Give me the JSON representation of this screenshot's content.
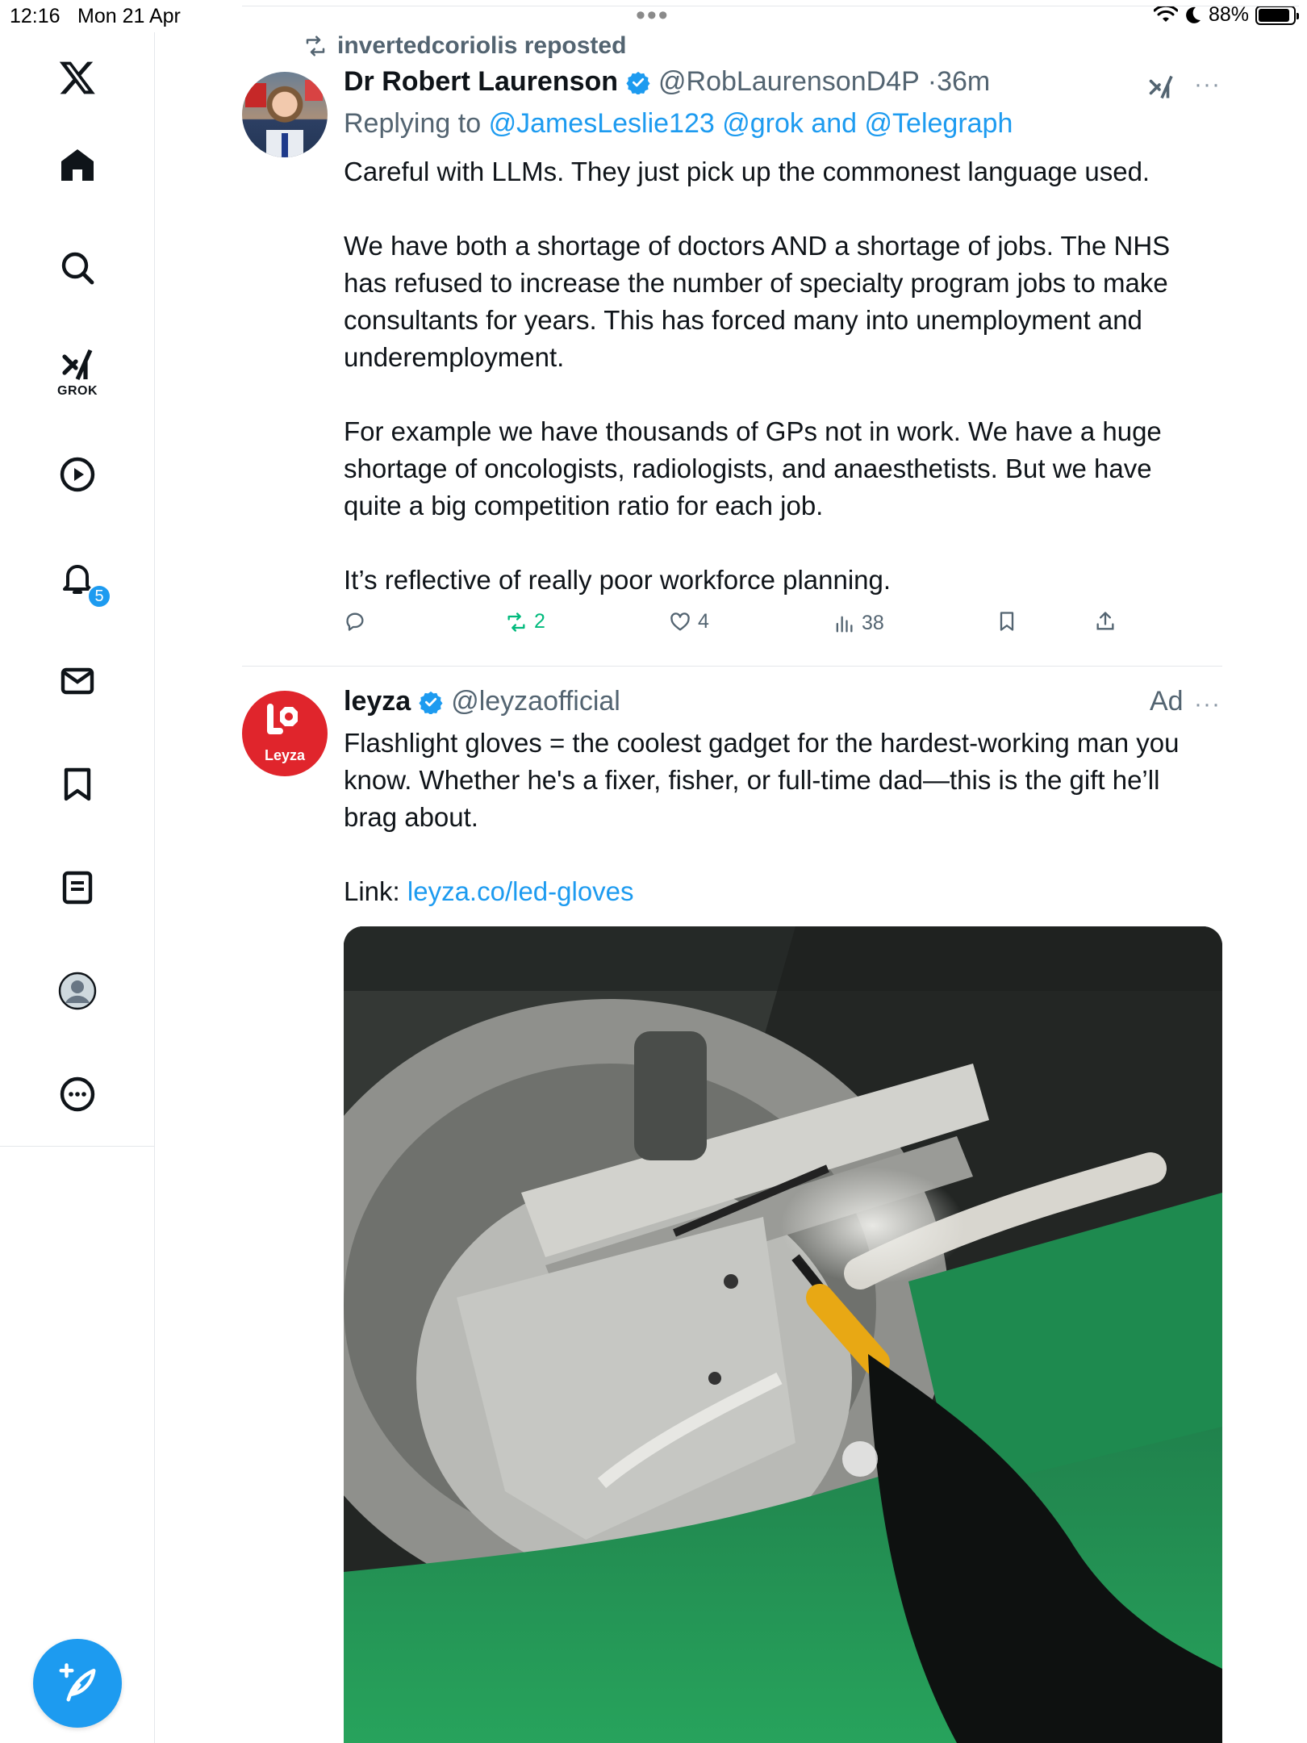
{
  "status_bar": {
    "time": "12:16",
    "date": "Mon 21 Apr",
    "battery": "88%",
    "battery_level": 0.88
  },
  "sidebar": {
    "items": [
      {
        "name": "x-logo",
        "label": ""
      },
      {
        "name": "home",
        "label": ""
      },
      {
        "name": "search",
        "label": ""
      },
      {
        "name": "grok",
        "label": "GROK"
      },
      {
        "name": "video",
        "label": ""
      },
      {
        "name": "notifications",
        "label": "",
        "badge": "5"
      },
      {
        "name": "messages",
        "label": ""
      },
      {
        "name": "bookmarks",
        "label": ""
      },
      {
        "name": "lists",
        "label": ""
      },
      {
        "name": "profile",
        "label": ""
      },
      {
        "name": "more",
        "label": ""
      }
    ],
    "accent": "#1d9bf0"
  },
  "tweet1": {
    "reposted_by": "invertedcoriolis reposted",
    "author_name": "Dr Robert Laurenson",
    "handle": "@RobLaurensonD4P",
    "time": "·36m",
    "replying_prefix": "Replying to",
    "replying_to_1": "@JamesLeslie123",
    "replying_to_2": "@grok",
    "replying_and": "and",
    "replying_to_3": "@Telegraph",
    "paragraph1": "Careful with LLMs. They just pick up the commonest language used.",
    "paragraph2_lines": [
      "We have both a shortage of doctors AND a shortage of jobs. The NHS",
      "has refused to increase the number of specialty program jobs to make",
      "consultants for years. This has forced many into unemployment and",
      "underemployment."
    ],
    "paragraph3_lines": [
      "For example we have thousands of GPs not in work. We have a huge",
      "shortage of oncologists, radiologists, and anaesthetists. But we have",
      "quite a big competition ratio for each job."
    ],
    "paragraph4": "It’s reflective of really poor workforce planning.",
    "reposts": "2",
    "likes": "4",
    "views": "38"
  },
  "tweet2": {
    "author_name": "leyza",
    "handle": "@leyzaofficial",
    "ad_label": "Ad",
    "avatar_text": "Leyza",
    "text_lines": [
      "Flashlight gloves = the coolest gadget for the hardest-working man you",
      "know. Whether he's a fixer, fisher, or full-time dad—this is the gift he’ll",
      "brag about."
    ],
    "link_prefix": "Link:",
    "link": "leyza.co/led-gloves",
    "media_alt": "video-thumbnail"
  }
}
